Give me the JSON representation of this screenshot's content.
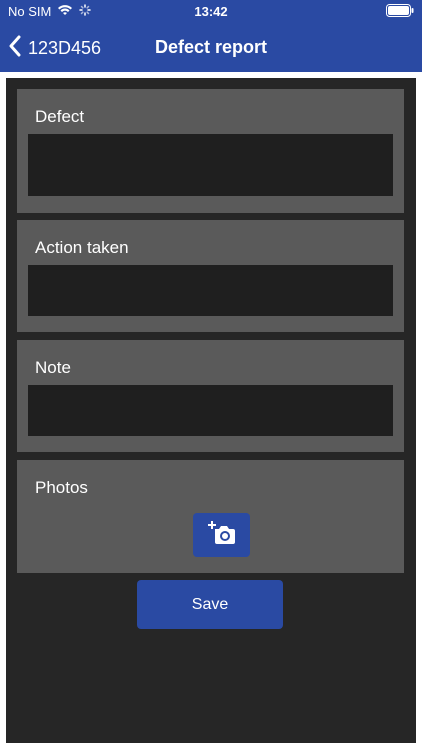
{
  "status_bar": {
    "carrier": "No SIM",
    "time": "13:42",
    "icons": [
      "wifi-icon",
      "activity-spinner-icon",
      "battery-icon"
    ]
  },
  "nav": {
    "back_label": "123D456",
    "title": "Defect report",
    "back_icon": "chevron-left-icon"
  },
  "form": {
    "defect_label": "Defect",
    "defect_value": "",
    "action_label": "Action taken",
    "action_value": "",
    "note_label": "Note",
    "note_value": "",
    "photos_label": "Photos",
    "camera_icon": "add-photo-camera-icon"
  },
  "actions": {
    "save_label": "Save"
  },
  "colors": {
    "primary": "#2a4aa3",
    "background": "#262626",
    "card": "#5a5a5a",
    "input": "#1f1f1f",
    "text": "#ffffff"
  }
}
